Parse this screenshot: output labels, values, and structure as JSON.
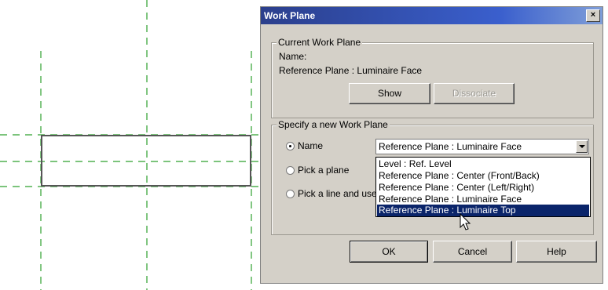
{
  "dialog": {
    "title": "Work Plane",
    "close_label": "×",
    "current_group": {
      "legend": "Current Work Plane",
      "name_label": "Name:",
      "name_value": "Reference Plane : Luminaire Face",
      "show_label": "Show",
      "dissociate_label": "Dissociate"
    },
    "specify_group": {
      "legend": "Specify a new Work Plane",
      "options": [
        {
          "label": "Name",
          "checked": true
        },
        {
          "label": "Pick a plane",
          "checked": false
        },
        {
          "label": "Pick a line and use",
          "checked": false
        }
      ],
      "combo_value": "Reference Plane : Luminaire Face",
      "dropdown_items": [
        "Level : Ref. Level",
        "Reference Plane : Center (Front/Back)",
        "Reference Plane : Center (Left/Right)",
        "Reference Plane : Luminaire Face",
        "Reference Plane : Luminaire Top"
      ],
      "selected_index": 4
    },
    "ok_label": "OK",
    "cancel_label": "Cancel",
    "help_label": "Help"
  },
  "colors": {
    "titlebar": "#2b3f8c",
    "dialog_bg": "#d4d0c8",
    "selection": "#0a246a",
    "ref_plane_line": "#2ea02e"
  }
}
